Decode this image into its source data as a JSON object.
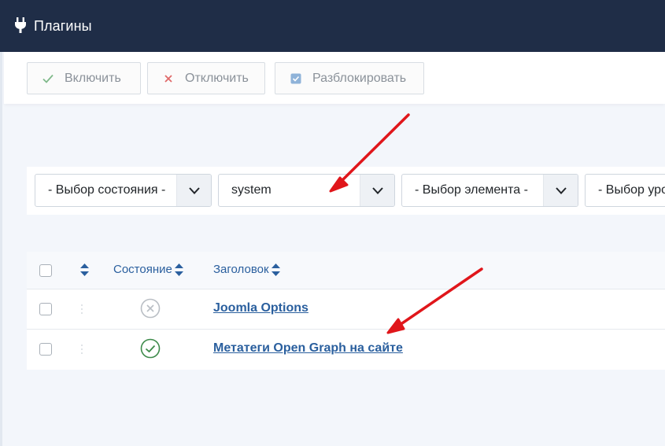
{
  "header": {
    "title": "Плагины",
    "icon": "plug-icon"
  },
  "toolbar": {
    "enable_label": "Включить",
    "disable_label": "Отключить",
    "unlock_label": "Разблокировать"
  },
  "filters": {
    "state": "- Выбор состояния -",
    "folder": "system",
    "element": "- Выбор элемента -",
    "level": "- Выбор уро"
  },
  "table": {
    "columns": {
      "state": "Состояние",
      "title": "Заголовок"
    },
    "rows": [
      {
        "title": "Joomla Options",
        "status": "disabled"
      },
      {
        "title": "Метатеги Open Graph на сайте",
        "status": "enabled"
      }
    ]
  },
  "colors": {
    "header_bg": "#1f2d47",
    "link": "#2a5f9e",
    "enabled": "#3d8a4a",
    "disabled": "#b9bec4",
    "arrow": "#e0161b"
  }
}
